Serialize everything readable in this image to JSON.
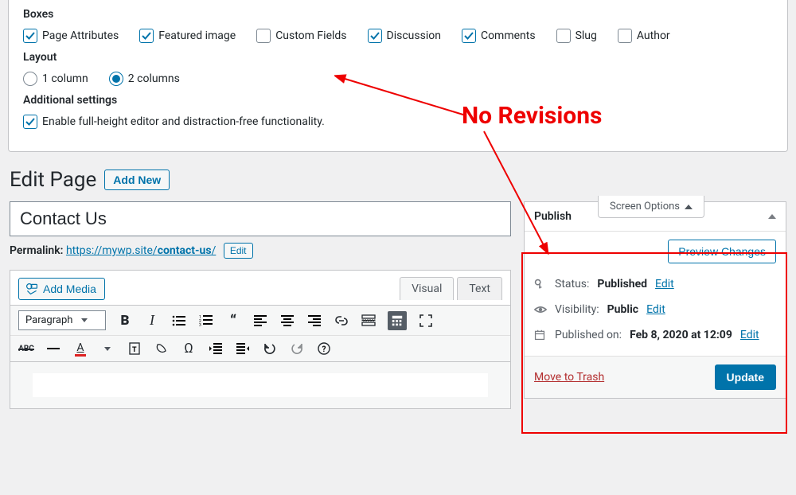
{
  "screen_options": {
    "boxes_title": "Boxes",
    "boxes": [
      {
        "label": "Page Attributes",
        "checked": true
      },
      {
        "label": "Featured image",
        "checked": true
      },
      {
        "label": "Custom Fields",
        "checked": false
      },
      {
        "label": "Discussion",
        "checked": true
      },
      {
        "label": "Comments",
        "checked": true
      },
      {
        "label": "Slug",
        "checked": false
      },
      {
        "label": "Author",
        "checked": false
      }
    ],
    "layout_title": "Layout",
    "layout_options": [
      {
        "label": "1 column",
        "selected": false
      },
      {
        "label": "2 columns",
        "selected": true
      }
    ],
    "additional_title": "Additional settings",
    "full_height": {
      "label": "Enable full-height editor and distraction-free functionality.",
      "checked": true
    },
    "tab_label": "Screen Options"
  },
  "header": {
    "page_title": "Edit Page",
    "add_new": "Add New"
  },
  "editor": {
    "title_value": "Contact Us",
    "permalink_label": "Permalink:",
    "permalink_base": "https://mywp.site/",
    "permalink_slug": "contact-us",
    "permalink_trail": "/",
    "edit_label": "Edit",
    "add_media_label": "Add Media",
    "tab_visual": "Visual",
    "tab_text": "Text",
    "format_label": "Paragraph",
    "abc_label": "ABC"
  },
  "publish": {
    "box_title": "Publish",
    "preview_label": "Preview Changes",
    "status_label": "Status:",
    "status_value": "Published",
    "visibility_label": "Visibility:",
    "visibility_value": "Public",
    "published_label": "Published on:",
    "published_value": "Feb 8, 2020 at 12:09",
    "edit_link": "Edit",
    "trash_label": "Move to Trash",
    "update_label": "Update"
  },
  "annotation": {
    "text": "No Revisions"
  }
}
